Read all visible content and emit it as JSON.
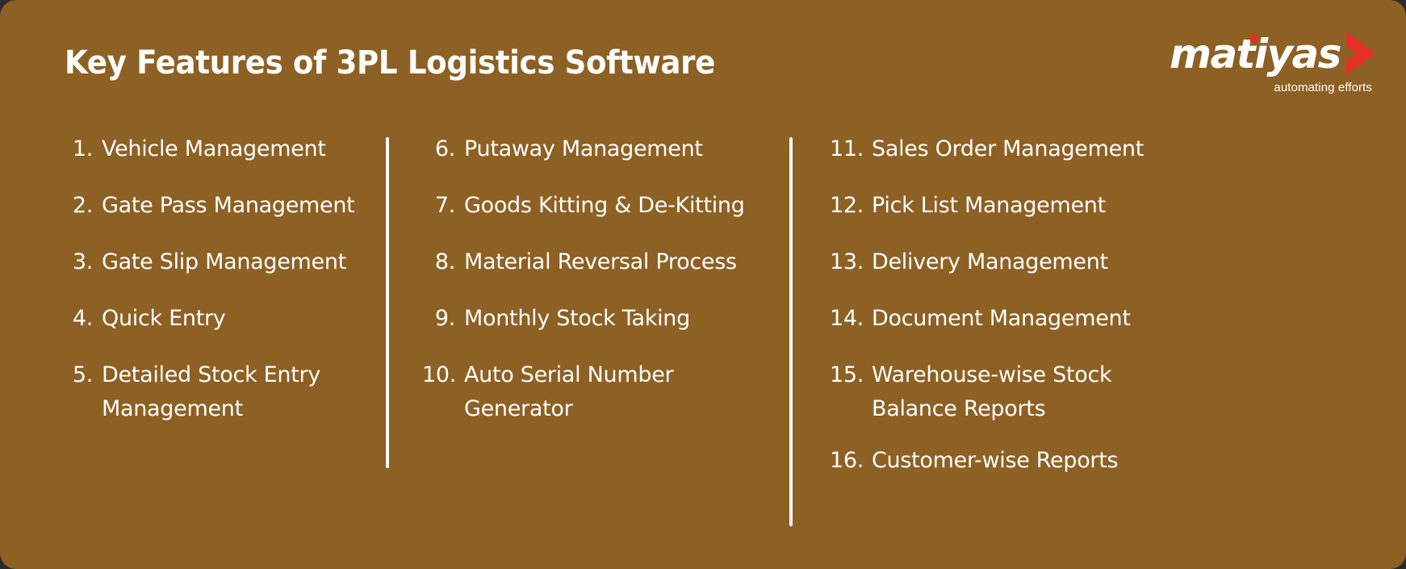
{
  "header": {
    "title": "Key Features of 3PL Logistics Software"
  },
  "logo": {
    "wordmark": "matiyas",
    "tagline": "automating efforts",
    "accent_color": "#e63027",
    "chevron_icon": "chevron-right-icon",
    "dot_icon": "dot-icon"
  },
  "theme": {
    "background_color": "#8d6023",
    "text_color": "#ffffff",
    "accent_color": "#e63027"
  },
  "columns": [
    {
      "id": "column-1",
      "divider": false,
      "items": [
        {
          "num": "1.",
          "label": "Vehicle Management"
        },
        {
          "num": "2.",
          "label": "Gate Pass Management"
        },
        {
          "num": "3.",
          "label": "Gate Slip Management"
        },
        {
          "num": "4.",
          "label": "Quick Entry"
        },
        {
          "num": "5.",
          "label": "Detailed Stock Entry\nManagement"
        }
      ]
    },
    {
      "id": "column-2",
      "divider": true,
      "items": [
        {
          "num": "6.",
          "label": "Putaway Management"
        },
        {
          "num": "7.",
          "label": "Goods Kitting & De-Kitting"
        },
        {
          "num": "8.",
          "label": "Material Reversal Process"
        },
        {
          "num": "9.",
          "label": "Monthly Stock Taking"
        },
        {
          "num": "10.",
          "label": "Auto Serial Number\nGenerator"
        }
      ]
    },
    {
      "id": "column-3",
      "divider": true,
      "items": [
        {
          "num": "11.",
          "label": "Sales Order Management"
        },
        {
          "num": "12.",
          "label": "Pick List Management"
        },
        {
          "num": "13.",
          "label": "Delivery Management"
        },
        {
          "num": "14.",
          "label": "Document Management"
        },
        {
          "num": "15.",
          "label": "Warehouse-wise Stock\nBalance Reports"
        },
        {
          "num": "16.",
          "label": "Customer-wise Reports"
        }
      ]
    }
  ]
}
